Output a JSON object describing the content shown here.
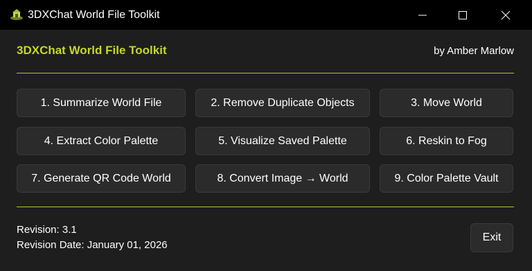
{
  "window": {
    "title": "3DXChat World File Toolkit",
    "icon": "toolkit-app-icon",
    "controls": [
      "minimize-icon",
      "maximize-icon",
      "close-icon"
    ]
  },
  "header": {
    "title": "3DXChat World File Toolkit",
    "author": "by Amber Marlow"
  },
  "actions": [
    {
      "label": "1. Summarize World File"
    },
    {
      "label": "2. Remove Duplicate Objects"
    },
    {
      "label": "3. Move World"
    },
    {
      "label": "4. Extract Color Palette"
    },
    {
      "label": "5. Visualize Saved Palette"
    },
    {
      "label": "6. Reskin to Fog"
    },
    {
      "label": "7. Generate QR Code World"
    },
    {
      "label": "8. Convert Image → World"
    },
    {
      "label": "9. Color Palette Vault"
    }
  ],
  "footer": {
    "revision": "Revision: 3.1",
    "revision_date": "Revision Date: January 01, 2026",
    "exit_label": "Exit"
  },
  "colors": {
    "accent": "#c5d62f",
    "background": "#1e1e1e",
    "titlebar": "#000000",
    "button": "#2b2b2b"
  }
}
